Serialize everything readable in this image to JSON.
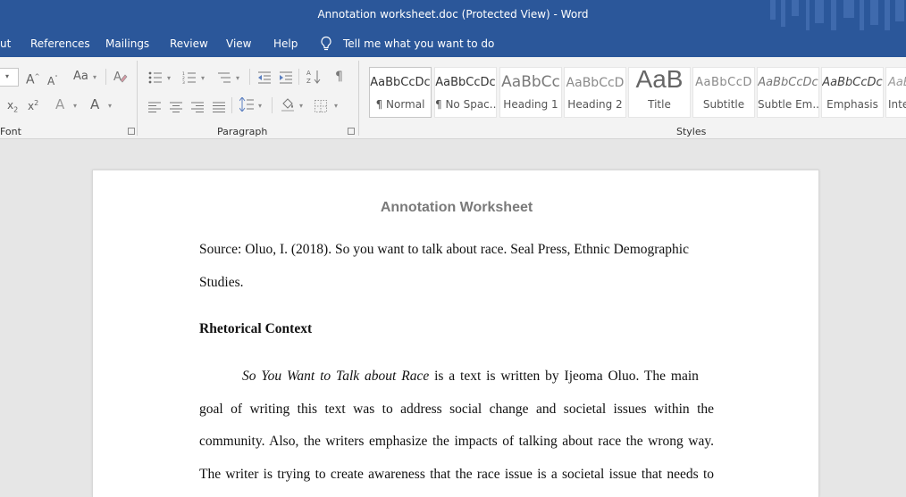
{
  "window": {
    "title": "Annotation worksheet.doc (Protected View)  -  Word"
  },
  "menu": {
    "tabs": [
      "ut",
      "References",
      "Mailings",
      "Review",
      "View",
      "Help"
    ],
    "tell_me": "Tell me what you want to do"
  },
  "ribbon": {
    "groups": {
      "font": "Font",
      "paragraph": "Paragraph",
      "styles": "Styles"
    },
    "font_buttons": {
      "grow": "A",
      "shrink": "A",
      "change_case": "Aa",
      "subscript": "x",
      "superscript": "x",
      "effects": "A",
      "font_color": "A"
    },
    "styles": [
      {
        "sample": "AaBbCcDc",
        "name": "¶ Normal"
      },
      {
        "sample": "AaBbCcDc",
        "name": "¶ No Spac..."
      },
      {
        "sample": "AaBbCc",
        "name": "Heading 1"
      },
      {
        "sample": "AaBbCcD",
        "name": "Heading 2"
      },
      {
        "sample": "AaB",
        "name": "Title"
      },
      {
        "sample": "AaBbCcD",
        "name": "Subtitle"
      },
      {
        "sample": "AaBbCcDc",
        "name": "Subtle Em..."
      },
      {
        "sample": "AaBbCcDc",
        "name": "Emphasis"
      },
      {
        "sample": "AaB",
        "name": "Inte"
      }
    ]
  },
  "document": {
    "title": "Annotation Worksheet",
    "source_line1": "Source: Oluo, I. (2018). So you want to talk about race. Seal Press, Ethnic Demographic",
    "source_line2": "Studies.",
    "heading": "Rhetorical Context",
    "para_italic": "So You Want to Talk about Race",
    "para_line1_rest": " is a text is written by Ijeoma Oluo. The main",
    "para_line2": "goal of writing this text was to address social change and societal issues within the",
    "para_line3": "community. Also, the writers emphasize the impacts of talking about race the wrong way.",
    "para_line4": "The writer is trying to create awareness that the race issue is a societal issue that needs to"
  },
  "colors": {
    "accent": "#2b579a",
    "ribbon": "#f3f3f3",
    "canvas": "#e6e6e6"
  }
}
